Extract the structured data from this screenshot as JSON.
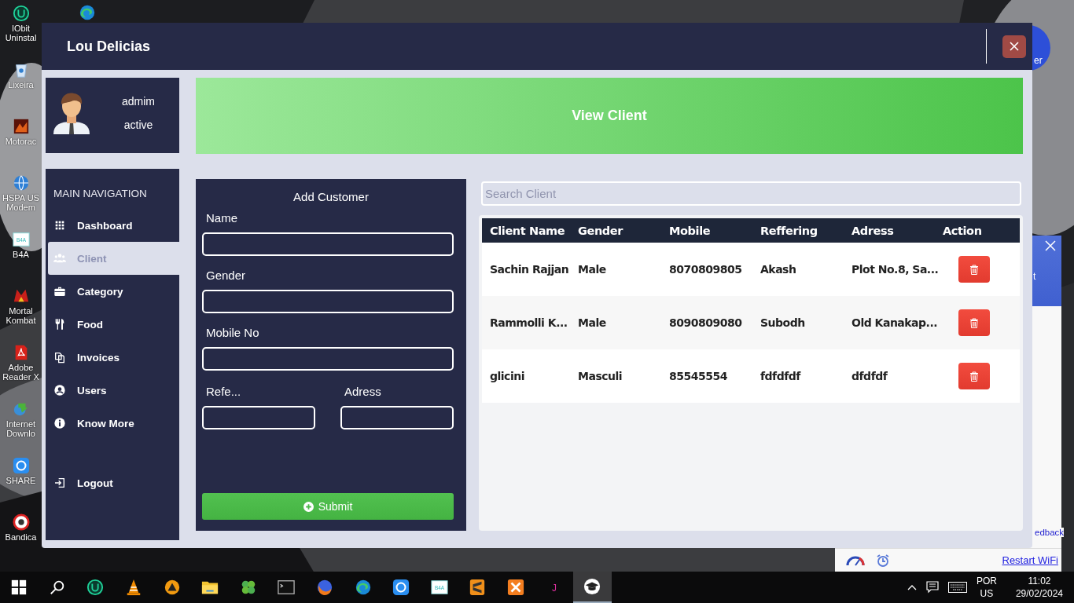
{
  "desktop": {
    "icons": [
      {
        "kind": "iobit",
        "label": "IObit Uninstal"
      },
      {
        "kind": "recycle",
        "label": "Lixeira"
      },
      {
        "kind": "game",
        "label": "Motorac"
      },
      {
        "kind": "globe",
        "label": "HSPA US Modem"
      },
      {
        "kind": "b4a",
        "label": "B4A",
        "logo_text": "B4A"
      },
      {
        "kind": "mk",
        "label": "Mortal Kombat"
      },
      {
        "kind": "pdf",
        "label": "Adobe Reader X"
      },
      {
        "kind": "idm",
        "label": "Internet Downlo"
      },
      {
        "kind": "shareit",
        "label": "SHARE"
      },
      {
        "kind": "bandicam",
        "label": "Bandica"
      }
    ],
    "badge_text": "er"
  },
  "notification": {
    "header_text": "t",
    "body_link": "edback",
    "footer_link": "Restart WiFi"
  },
  "window": {
    "title": "Lou Delicias"
  },
  "profile": {
    "name": "admim",
    "status": "active"
  },
  "nav": {
    "heading": "MAIN NAVIGATION",
    "items": [
      {
        "kind": "grid",
        "label": "Dashboard",
        "selected": false
      },
      {
        "kind": "users",
        "label": "Client",
        "selected": true
      },
      {
        "kind": "briefcase",
        "label": "Category",
        "selected": false
      },
      {
        "kind": "cutlery",
        "label": "Food",
        "selected": false
      },
      {
        "kind": "documents",
        "label": "Invoices",
        "selected": false
      },
      {
        "kind": "user",
        "label": "Users",
        "selected": false
      },
      {
        "kind": "info",
        "label": "Know More",
        "selected": false
      }
    ],
    "logout": {
      "label": "Logout"
    }
  },
  "banner": {
    "title": "View Client"
  },
  "form": {
    "title": "Add Customer",
    "fields": [
      {
        "label": "Name",
        "kind": "full"
      },
      {
        "label": "Gender",
        "kind": "full"
      },
      {
        "label": "Mobile No",
        "kind": "full"
      },
      {
        "label": "Refe...",
        "kind": "half"
      },
      {
        "label": "Adress",
        "kind": "half"
      }
    ],
    "submit": "Submit"
  },
  "search": {
    "placeholder": "Search Client"
  },
  "table": {
    "columns": [
      "Client Name",
      "Gender",
      "Mobile",
      "Reffering",
      "Adress",
      "Action"
    ],
    "rows": [
      {
        "cells": [
          "Sachin Rajjan",
          "Male",
          "8070809805",
          "Akash",
          "Plot No.8, Sa..."
        ]
      },
      {
        "cells": [
          "Rammolli K...",
          "Male",
          "8090809080",
          "Subodh",
          "Old Kanakap..."
        ]
      },
      {
        "cells": [
          "glicini",
          "Masculi",
          "85545554",
          "fdfdfdf",
          "dfdfdf"
        ]
      }
    ]
  },
  "taskbar": {
    "items": [
      {
        "kind": "start",
        "selected": false
      },
      {
        "kind": "search",
        "selected": false
      },
      {
        "kind": "iobit",
        "selected": false
      },
      {
        "kind": "vlc",
        "selected": false
      },
      {
        "kind": "aimp",
        "selected": false
      },
      {
        "kind": "folder",
        "selected": false
      },
      {
        "kind": "clover",
        "selected": false
      },
      {
        "kind": "terminal",
        "selected": false
      },
      {
        "kind": "firefox",
        "selected": false
      },
      {
        "kind": "edge",
        "selected": false
      },
      {
        "kind": "shareit",
        "selected": false
      },
      {
        "kind": "b4a",
        "selected": false,
        "logo_text": "B4A"
      },
      {
        "kind": "sublime",
        "selected": false
      },
      {
        "kind": "xampp",
        "selected": false
      },
      {
        "kind": "jlogo",
        "selected": false,
        "logo_text": "J"
      },
      {
        "kind": "mortar",
        "selected": true
      }
    ],
    "language": [
      "POR",
      "US"
    ],
    "time": "11:02",
    "date": "29/02/2024"
  }
}
